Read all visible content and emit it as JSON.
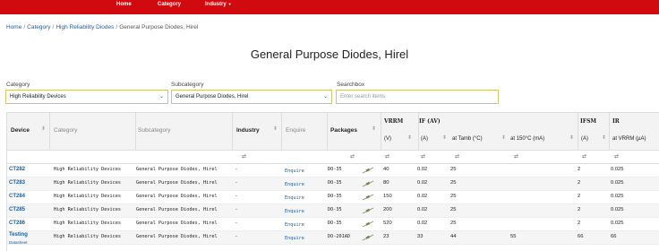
{
  "nav": {
    "items": [
      "Home",
      "Category",
      "Industry"
    ]
  },
  "breadcrumb": {
    "home": "Home",
    "category": "Category",
    "subcategory": "High Reliability Diodes",
    "current": "General Purpose Diodes, Hirel"
  },
  "page_title": "General Purpose Diodes, Hirel",
  "filters": {
    "category": {
      "label": "Category",
      "value": "High Reliability Devices"
    },
    "subcategory": {
      "label": "Subcategory",
      "value": "General Purpose Diodes, Hirel"
    },
    "search": {
      "label": "Searchbox",
      "placeholder": "Enter search items"
    }
  },
  "table": {
    "headers": {
      "device": "Device",
      "category": "Category",
      "subcategory": "Subcategory",
      "industry": "Industry",
      "enquire": "Enquire",
      "packages": "Packages",
      "vrrm": "VRRM",
      "if": "IF (AV)",
      "ifsm": "IFSM",
      "ir": "IR"
    },
    "subheaders": {
      "vrrm_unit": "(V)",
      "if_unit": "(A)",
      "if_tamb": "at Tamb (°C)",
      "if_150": "at 150°C (mA)",
      "ifsm_unit": "(A)",
      "ir_unit": "at VRRM (µA)"
    },
    "rows": [
      {
        "device": "CT282",
        "category": "High Reliability Devices",
        "subcategory": "General Purpose Diodes, Hirel",
        "industry": "-",
        "enquire": "Enquire",
        "package": "DO-35",
        "vrrm": "40",
        "if": "0.02",
        "tamb": "25",
        "at150": "",
        "ifsm": "2",
        "ir": "0.025"
      },
      {
        "device": "CT283",
        "category": "High Reliability Devices",
        "subcategory": "General Purpose Diodes, Hirel",
        "industry": "-",
        "enquire": "Enquire",
        "package": "DO-35",
        "vrrm": "80",
        "if": "0.02",
        "tamb": "25",
        "at150": "",
        "ifsm": "2",
        "ir": "0.025"
      },
      {
        "device": "CT284",
        "category": "High Reliability Devices",
        "subcategory": "General Purpose Diodes, Hirel",
        "industry": "-",
        "enquire": "Enquire",
        "package": "DO-35",
        "vrrm": "150",
        "if": "0.02",
        "tamb": "25",
        "at150": "",
        "ifsm": "2",
        "ir": "0.025"
      },
      {
        "device": "CT285",
        "category": "High Reliability Devices",
        "subcategory": "General Purpose Diodes, Hirel",
        "industry": "-",
        "enquire": "Enquire",
        "package": "DO-35",
        "vrrm": "200",
        "if": "0.02",
        "tamb": "25",
        "at150": "",
        "ifsm": "2",
        "ir": "0.025"
      },
      {
        "device": "CT286",
        "category": "High Reliability Devices",
        "subcategory": "General Purpose Diodes, Hirel",
        "industry": "-",
        "enquire": "Enquire",
        "package": "DO-35",
        "vrrm": "520",
        "if": "0.02",
        "tamb": "25",
        "at150": "",
        "ifsm": "2",
        "ir": "0.025"
      },
      {
        "device": "Testing",
        "device_sub": "Datasheet",
        "category": "High Reliability Devices",
        "subcategory": "General Purpose Diodes, Hirel",
        "industry": "-",
        "enquire": "Enquire",
        "package": "DO-201AD",
        "vrrm": "23",
        "if": "33",
        "tamb": "44",
        "at150": "55",
        "ifsm": "66",
        "ir": "66"
      }
    ]
  },
  "colors": {
    "nav": "#d10a10",
    "link": "#1d5d9b",
    "filter_border": "#d6c56a"
  }
}
